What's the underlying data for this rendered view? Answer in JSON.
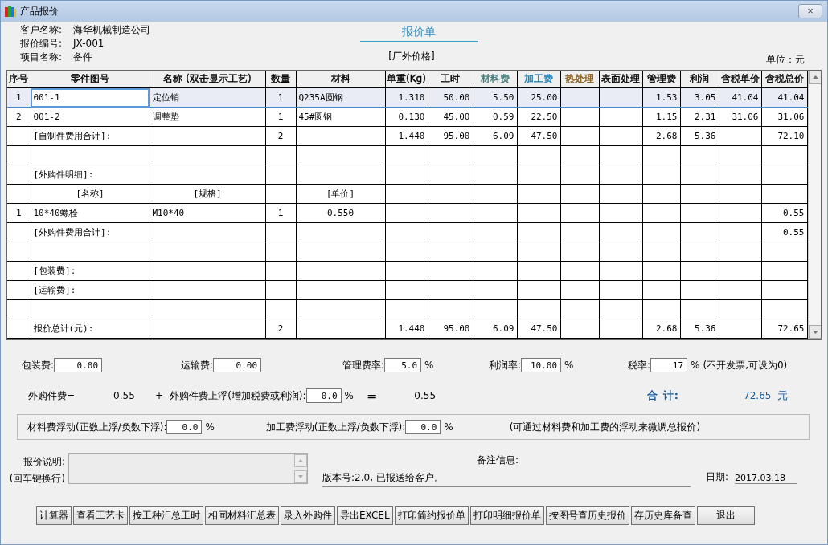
{
  "window": {
    "title": "产品报价",
    "close": "×"
  },
  "header": {
    "fields": [
      {
        "label": "客户名称:",
        "value": "海华机械制造公司"
      },
      {
        "label": "报价编号:",
        "value": "JX-001"
      },
      {
        "label": "项目名称:",
        "value": "备件"
      }
    ],
    "doc_title": "报价单",
    "price_type": "[厂外价格]",
    "unit": "单位：元"
  },
  "table": {
    "columns": [
      {
        "label": "序号",
        "color": "#000000"
      },
      {
        "label": "零件图号",
        "color": "#000000"
      },
      {
        "label": "名称 (双击显示工艺)",
        "color": "#000000"
      },
      {
        "label": "数量",
        "color": "#000000"
      },
      {
        "label": "材料",
        "color": "#000000"
      },
      {
        "label": "单重(Kg)",
        "color": "#000000"
      },
      {
        "label": "工时",
        "color": "#000000"
      },
      {
        "label": "材料费",
        "color": "#3f7a78"
      },
      {
        "label": "加工费",
        "color": "#1a82b8"
      },
      {
        "label": "热处理",
        "color": "#8a5a14"
      },
      {
        "label": "表面处理",
        "color": "#000000"
      },
      {
        "label": "管理费",
        "color": "#000000"
      },
      {
        "label": "利润",
        "color": "#000000"
      },
      {
        "label": "含税单价",
        "color": "#000000"
      },
      {
        "label": "含税总价",
        "color": "#000000"
      }
    ],
    "rows": [
      {
        "kind": "item",
        "selected": true,
        "cells": [
          "1",
          "001-1",
          "定位销",
          "1",
          "Q235A圆钢",
          "1.310",
          "50.00",
          "5.50",
          "25.00",
          null,
          null,
          "1.53",
          "3.05",
          "41.04",
          "41.04"
        ]
      },
      {
        "kind": "item",
        "selected": false,
        "cells": [
          "2",
          "001-2",
          "调整垫",
          "1",
          "45#圆钢",
          "0.130",
          "45.00",
          "0.59",
          "22.50",
          null,
          null,
          "1.15",
          "2.31",
          "31.06",
          "31.06"
        ]
      },
      {
        "kind": "item",
        "selected": false,
        "cells": [
          null,
          "[自制件费用合计]:",
          null,
          "2",
          null,
          "1.440",
          "95.00",
          "6.09",
          "47.50",
          null,
          null,
          "2.68",
          "5.36",
          null,
          "72.10"
        ]
      },
      {
        "kind": "item",
        "selected": false,
        "cells": [
          null,
          null,
          null,
          null,
          null,
          null,
          null,
          null,
          null,
          null,
          null,
          null,
          null,
          null,
          null
        ]
      },
      {
        "kind": "item",
        "selected": false,
        "cells": [
          null,
          "[外购件明细]:",
          null,
          null,
          null,
          null,
          null,
          null,
          null,
          null,
          null,
          null,
          null,
          null,
          null
        ]
      },
      {
        "kind": "subheader",
        "selected": false,
        "cells": [
          null,
          "[名称]",
          "[规格]",
          null,
          "[单价]",
          null,
          null,
          null,
          null,
          null,
          null,
          null,
          null,
          null,
          null
        ]
      },
      {
        "kind": "purchase",
        "selected": false,
        "cells": [
          "1",
          "10*40螺栓",
          "M10*40",
          "1",
          "0.550",
          null,
          null,
          null,
          null,
          null,
          null,
          null,
          null,
          null,
          "0.55"
        ]
      },
      {
        "kind": "item",
        "selected": false,
        "cells": [
          null,
          "[外购件费用合计]:",
          null,
          null,
          null,
          null,
          null,
          null,
          null,
          null,
          null,
          null,
          null,
          null,
          "0.55"
        ]
      },
      {
        "kind": "item",
        "selected": false,
        "cells": [
          null,
          null,
          null,
          null,
          null,
          null,
          null,
          null,
          null,
          null,
          null,
          null,
          null,
          null,
          null
        ]
      },
      {
        "kind": "item",
        "selected": false,
        "cells": [
          null,
          "[包装费]:",
          null,
          null,
          null,
          null,
          null,
          null,
          null,
          null,
          null,
          null,
          null,
          null,
          null
        ]
      },
      {
        "kind": "item",
        "selected": false,
        "cells": [
          null,
          "[运输费]:",
          null,
          null,
          null,
          null,
          null,
          null,
          null,
          null,
          null,
          null,
          null,
          null,
          null
        ]
      },
      {
        "kind": "item",
        "selected": false,
        "cells": [
          null,
          null,
          null,
          null,
          null,
          null,
          null,
          null,
          null,
          null,
          null,
          null,
          null,
          null,
          null
        ]
      },
      {
        "kind": "item",
        "selected": false,
        "cells": [
          null,
          "报价总计(元):",
          null,
          "2",
          null,
          "1.440",
          "95.00",
          "6.09",
          "47.50",
          null,
          null,
          "2.68",
          "5.36",
          null,
          "72.65"
        ]
      }
    ]
  },
  "fees": [
    {
      "label": "包装费:",
      "value": "0.00"
    },
    {
      "label": "运输费:",
      "value": "0.00"
    },
    {
      "label": "管理费率:",
      "value": "5.0",
      "suffix": "%"
    },
    {
      "label": "利润率:",
      "value": "10.00",
      "suffix": "%"
    },
    {
      "label": "税率:",
      "value": "17",
      "suffix": "%",
      "note": "(不开发票,可设为0)"
    }
  ],
  "purchase": {
    "label": "外购件费=",
    "amount": "0.55",
    "plus": "+",
    "markup_label": "外购件费上浮(增加税费或利润):",
    "markup_value": "0.0",
    "suffix": "%",
    "equals": "=",
    "result": "0.55",
    "total_label": "合 计:",
    "total_value": "72.65",
    "total_unit": "元"
  },
  "float": {
    "items": [
      {
        "label": "材料费浮动(正数上浮/负数下浮):",
        "value": "0.0",
        "suffix": "%"
      },
      {
        "label": "加工费浮动(正数上浮/负数下浮):",
        "value": "0.0",
        "suffix": "%"
      }
    ],
    "note": "(可通过材料费和加工费的浮动来微调总报价)"
  },
  "notes": {
    "label": "报价说明:",
    "hint": "(回车键换行)",
    "remark_label": "备注信息:",
    "remark": "版本号:2.0, 已报送给客户。",
    "date_label": "日期:",
    "date": "2017.03.18"
  },
  "buttons": [
    "计算器",
    "查看工艺卡",
    "按工种汇总工时",
    "相同材料汇总表",
    "录入外购件",
    "导出EXCEL",
    "打印简约报价单",
    "打印明细报价单",
    "按图号查历史报价",
    "存历史库备查",
    "退出"
  ]
}
